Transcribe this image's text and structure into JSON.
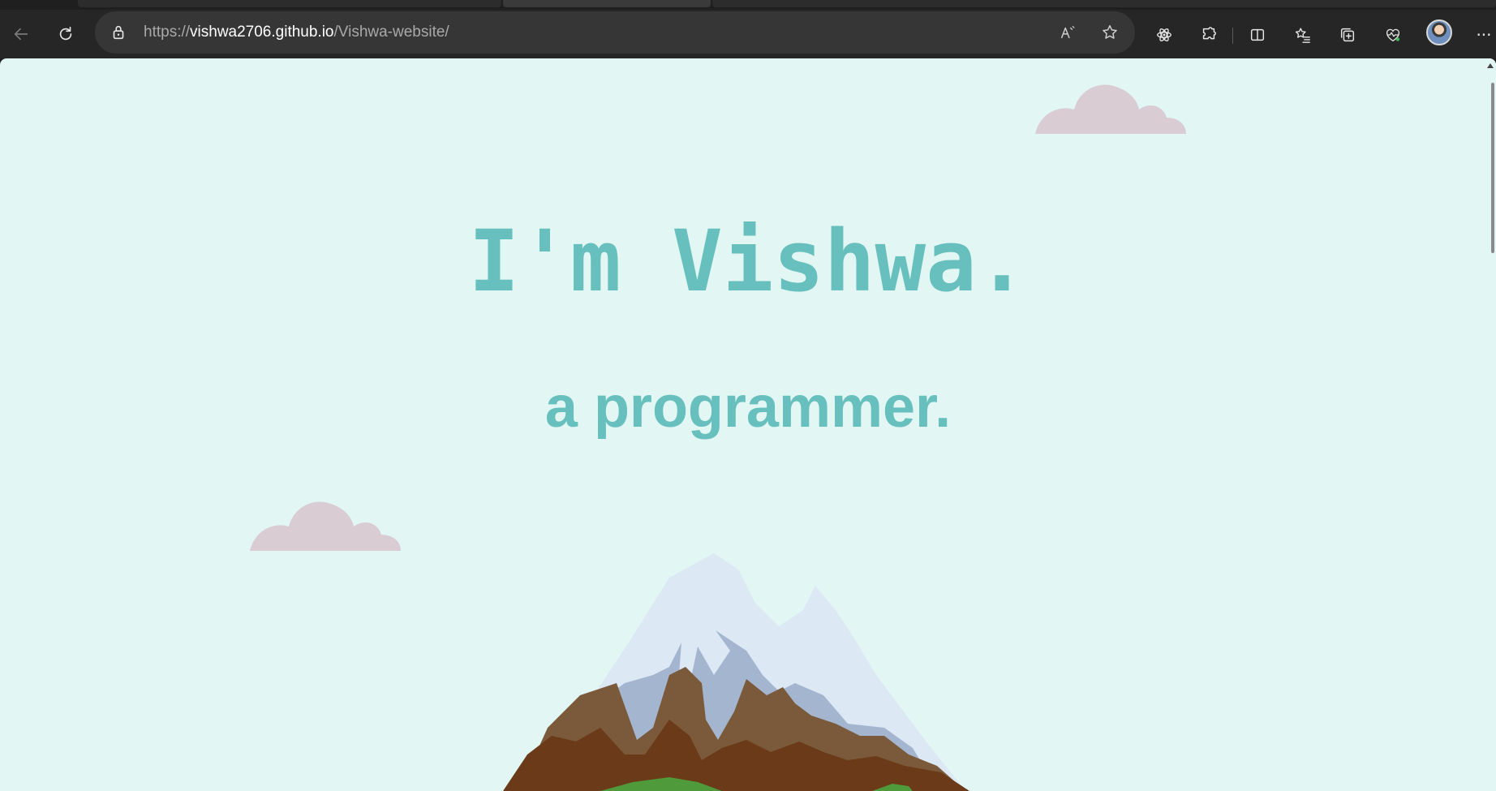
{
  "browser": {
    "url_scheme": "https://",
    "url_host": "vishwa2706.github.io",
    "url_path": "/Vishwa-website/",
    "read_aloud_label": "Ā",
    "more_label": "···"
  },
  "icons": {
    "back": "back-arrow-icon",
    "reload": "reload-icon",
    "lock": "lock-icon",
    "read_aloud": "read-aloud-icon",
    "favorite": "star-icon",
    "copilot": "atom-icon",
    "extensions": "puzzle-icon",
    "split_screen": "split-screen-icon",
    "favorites": "favorites-list-icon",
    "collections": "collections-icon",
    "performance": "heart-pulse-icon",
    "profile": "avatar",
    "more": "more-icon"
  },
  "page": {
    "headline": "I'm Vishwa.",
    "subline": "a programmer."
  },
  "colors": {
    "page_background": "#e2f6f3",
    "text_accent": "#67c0bd",
    "cloud": "#d9cdd3",
    "snow": "#dde8f5",
    "snow_shadow": "#a4b6cf",
    "rock_light": "#7a5a3a",
    "rock_dark": "#6b3a18",
    "grass": "#4f9a3a"
  }
}
